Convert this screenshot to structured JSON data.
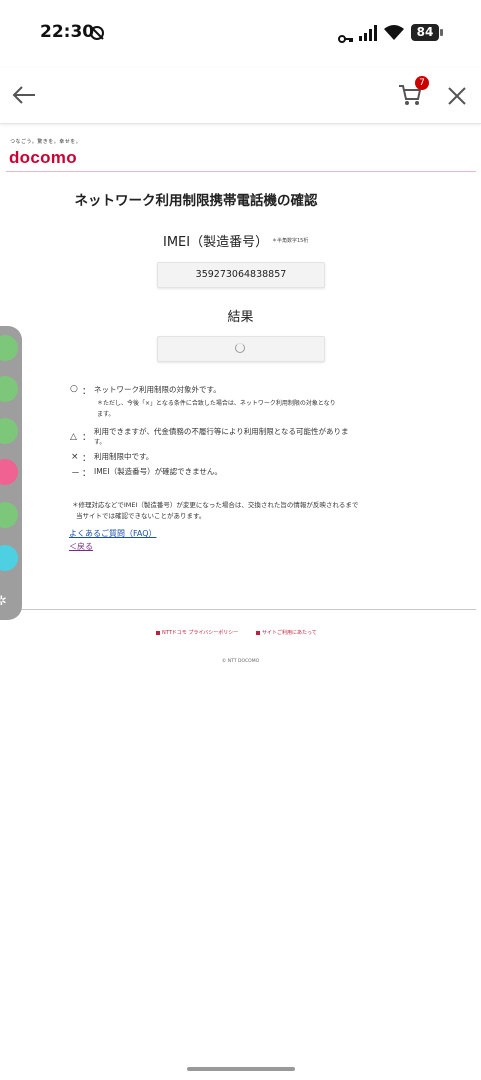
{
  "status_bar": {
    "time": "22:30",
    "battery": "84"
  },
  "toolbar": {
    "cart_count": "7"
  },
  "brand": {
    "tagline": "つなごう。驚きを。幸せを。",
    "logo": "docomo",
    "color": "#cc0033"
  },
  "page": {
    "title": "ネットワーク利用制限携帯電話機の確認",
    "imei_label": "IMEI（製造番号）",
    "imei_note": "＊半角数字15桁",
    "imei_value": "359273064838857",
    "result_label": "結果"
  },
  "legend": [
    {
      "symbol": "○",
      "sep": "：",
      "text": "ネットワーク利用制限の対象外です。"
    },
    {
      "symbol": "△",
      "sep": "：",
      "text": "利用できますが、代金債務の不履行等により利用制限となる可能性がありま"
    },
    {
      "symbol": "×",
      "sep": "：",
      "text": "利用制限中です。"
    },
    {
      "symbol": "－",
      "sep": "：",
      "text": "IMEI（製造番号）が確認できません。"
    }
  ],
  "legend_sub": {
    "circle_note_1": "＊ただし、今後「×」となる条件に合致した場合は、ネットワーク利用制限の対象となり",
    "circle_note_2": "ます。",
    "triangle_cont": "す。"
  },
  "note": {
    "line1": "＊修理対応などでIMEI（製造番号）が変更になった場合は、交換された旨の情報が反映されるまで",
    "line2": "当サイトでは確認できないことがあります。"
  },
  "links": {
    "faq": "よくあるご質問（FAQ）",
    "back": "＜戻る"
  },
  "footer": {
    "privacy": "NTTドコモ プライバシーポリシー",
    "about_site": "サイトご利用にあたって",
    "copyright": "© NTT DOCOMO"
  },
  "sidebar_colors": [
    "#7dc77b",
    "#7dc77b",
    "#7dc77b",
    "#f06292",
    "#7dc77b",
    "#4dd0e1"
  ]
}
